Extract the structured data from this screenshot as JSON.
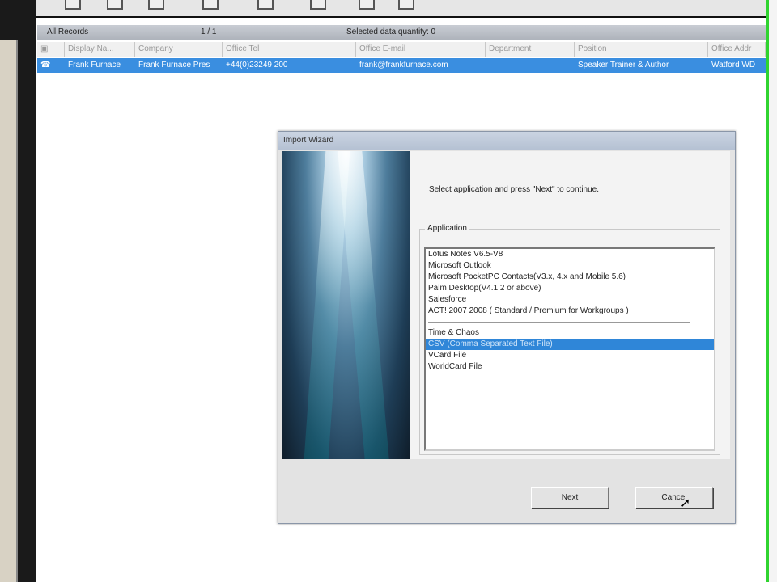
{
  "status": {
    "records_label": "All Records",
    "page": "1 / 1",
    "selected": "Selected data quantity: 0"
  },
  "columns": [
    "Display Na...",
    "Company",
    "Office Tel",
    "Office E-mail",
    "Department",
    "Position",
    "Office Addr"
  ],
  "row": [
    "Frank Furnace",
    "Frank Furnace Pres",
    "+44(0)23249 200",
    "frank@frankfurnace.com",
    "",
    "Speaker Trainer & Author",
    "Watford WD"
  ],
  "dialog": {
    "title": "Import Wizard",
    "instruction": "Select application and press \"Next\" to continue.",
    "group_label": "Application",
    "items": [
      "Lotus Notes V6.5-V8",
      "Microsoft Outlook",
      "Microsoft PocketPC Contacts(V3.x, 4.x and Mobile 5.6)",
      "Palm Desktop(V4.1.2 or above)",
      "Salesforce",
      "ACT! 2007 2008 ( Standard / Premium for Workgroups )"
    ],
    "items2": [
      "Time & Chaos",
      "CSV (Comma Separated Text File)",
      "VCard File",
      "WorldCard File"
    ],
    "selected": "CSV (Comma Separated Text File)",
    "next": "Next",
    "cancel": "Cancel"
  }
}
